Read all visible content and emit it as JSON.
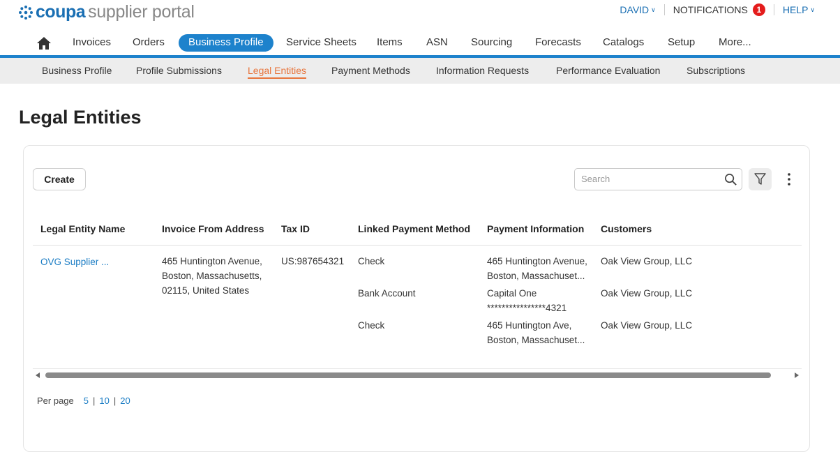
{
  "brand": {
    "logo_word": "coupa",
    "logo_rest": "supplier portal",
    "accent_color": "#1d82cc",
    "active_sub_color": "#e8743b"
  },
  "top_links": {
    "user": "DAVID",
    "notifications": "NOTIFICATIONS",
    "notification_count": "1",
    "help": "HELP"
  },
  "main_nav": {
    "home_icon": "home-icon",
    "items": [
      "Invoices",
      "Orders",
      "Business Profile",
      "Service Sheets",
      "Items",
      "ASN",
      "Sourcing",
      "Forecasts",
      "Catalogs",
      "Setup",
      "More..."
    ],
    "active": "Business Profile"
  },
  "sub_nav": {
    "items": [
      "Business Profile",
      "Profile Submissions",
      "Legal Entities",
      "Payment Methods",
      "Information Requests",
      "Performance Evaluation",
      "Subscriptions"
    ],
    "active": "Legal Entities"
  },
  "page": {
    "title": "Legal Entities"
  },
  "toolbar": {
    "create_label": "Create",
    "search_placeholder": "Search",
    "search_value": ""
  },
  "table": {
    "columns": [
      "Legal Entity Name",
      "Invoice From Address",
      "Tax ID",
      "Linked Payment Method",
      "Payment Information",
      "Customers"
    ],
    "row": {
      "legal_entity_name": "OVG Supplier ...",
      "invoice_address": [
        "465 Huntington Avenue,",
        "Boston, Massachusetts,",
        "02115, United States"
      ],
      "tax_id": "US:987654321",
      "payments": [
        {
          "method": "Check",
          "info": [
            "465 Huntington Avenue,",
            "Boston, Massachuset..."
          ],
          "customer": "Oak View Group, LLC"
        },
        {
          "method": "Bank Account",
          "info": [
            "Capital One",
            "****************4321"
          ],
          "customer": "Oak View Group, LLC"
        },
        {
          "method": "Check",
          "info": [
            "465 Huntington Ave,",
            "Boston, Massachuset..."
          ],
          "customer": "Oak View Group, LLC"
        }
      ]
    }
  },
  "pagination": {
    "label": "Per page",
    "options": [
      "5",
      "10",
      "20"
    ]
  }
}
